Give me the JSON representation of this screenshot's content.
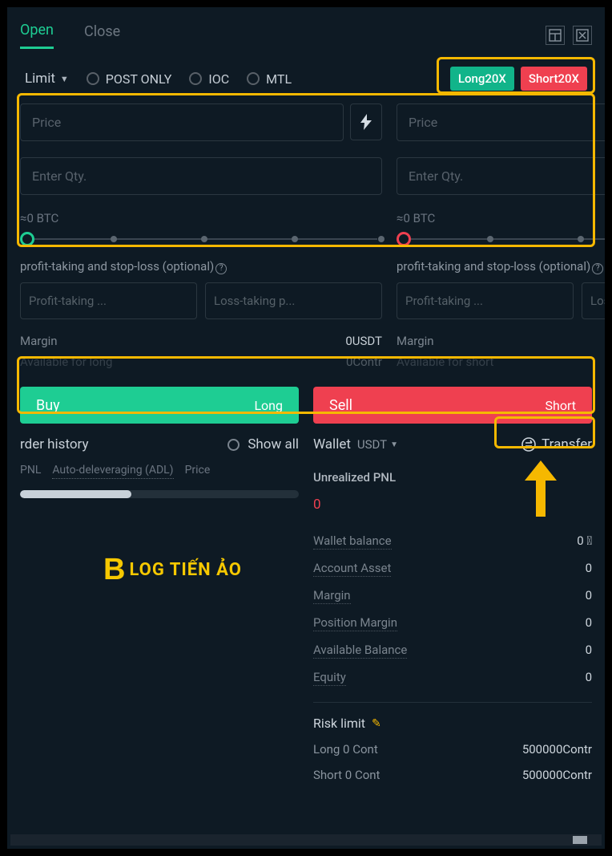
{
  "tabs": {
    "open": "Open",
    "close": "Close"
  },
  "orderType": {
    "limit": "Limit",
    "postOnly": "POST ONLY",
    "ioc": "IOC",
    "mtl": "MTL"
  },
  "leverage": {
    "long": "Long20X",
    "short": "Short20X"
  },
  "fields": {
    "pricePlaceholder": "Price",
    "qtyPlaceholder": "Enter Qty.",
    "approx": "≈0 BTC",
    "pslLabel": "profit-taking and stop-loss (optional)",
    "profitPlaceholder": "Profit-taking ...",
    "lossPlaceholder": "Loss-taking p..."
  },
  "stats": {
    "marginLabel": "Margin",
    "marginVal": "0USDT",
    "availLongLabel": "Available for long",
    "availShortLabel": "Available for short",
    "availVal": "0Contr"
  },
  "actions": {
    "buy": "Buy",
    "long": "Long",
    "sell": "Sell",
    "short": "Short"
  },
  "history": {
    "title": "rder history",
    "showAll": "Show all",
    "sub1": "PNL",
    "sub2": "Auto-deleveraging (ADL)",
    "sub3": "Price"
  },
  "watermark": {
    "b": "B",
    "rest": "LOG TIẾN ẢO"
  },
  "wallet": {
    "title": "Wallet",
    "currency": "USDT",
    "transfer": "Transfer",
    "unrealizedLabel": "Unrealized PNL",
    "unrealizedVal": "0",
    "rows": [
      {
        "label": "Wallet balance",
        "val": "0 ⃝"
      },
      {
        "label": "Account Asset",
        "val": "0"
      },
      {
        "label": "Margin",
        "val": "0"
      },
      {
        "label": "Position Margin",
        "val": "0"
      },
      {
        "label": "Available Balance",
        "val": "0"
      },
      {
        "label": "Equity",
        "val": "0"
      }
    ],
    "risk": {
      "title": "Risk limit",
      "longLabel": "Long 0 Cont",
      "shortLabel": "Short 0 Cont",
      "limitVal": "500000Contr"
    }
  }
}
